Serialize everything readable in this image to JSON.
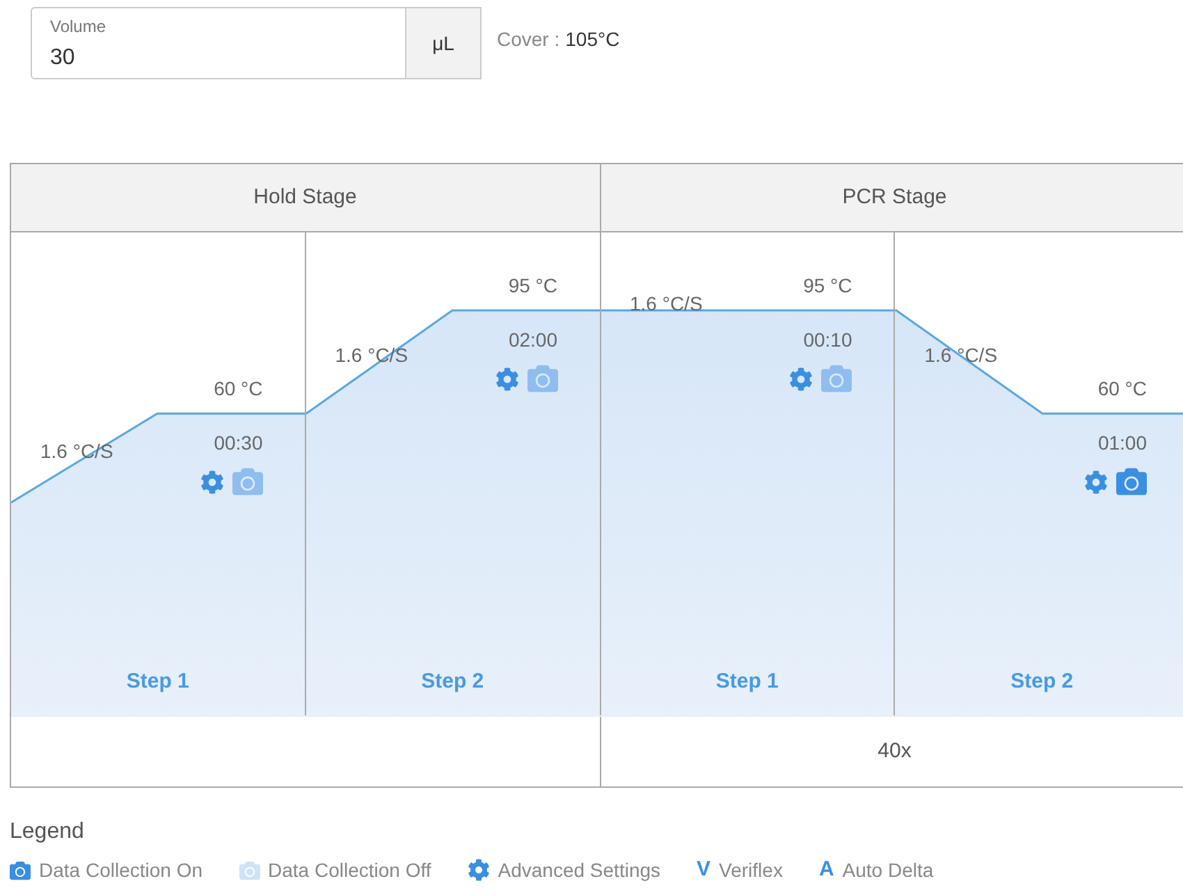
{
  "volume": {
    "label": "Volume",
    "value": "30",
    "unit": "μL"
  },
  "cover": {
    "label": "Cover :",
    "value": "105°C"
  },
  "stages": [
    {
      "title": "Hold Stage",
      "steps": [
        {
          "name": "Step 1",
          "ramp": "1.6 °C/S",
          "temp": "60 °C",
          "time": "00:30",
          "data_collection": false
        },
        {
          "name": "Step 2",
          "ramp": "1.6 °C/S",
          "temp": "95 °C",
          "time": "02:00",
          "data_collection": false
        }
      ]
    },
    {
      "title": "PCR Stage",
      "cycles": "40x",
      "steps": [
        {
          "name": "Step 1",
          "ramp": "1.6 °C/S",
          "temp": "95 °C",
          "time": "00:10",
          "data_collection": false
        },
        {
          "name": "Step 2",
          "ramp": "1.6 °C/S",
          "temp": "60 °C",
          "time": "01:00",
          "data_collection": true
        }
      ]
    }
  ],
  "legend": {
    "title": "Legend",
    "items": [
      {
        "kind": "camera_on",
        "label": "Data Collection On"
      },
      {
        "kind": "camera_off",
        "label": "Data Collection Off"
      },
      {
        "kind": "gear",
        "label": "Advanced Settings"
      },
      {
        "kind": "letter",
        "symbol": "V",
        "label": "Veriflex"
      },
      {
        "kind": "letter",
        "symbol": "A",
        "label": "Auto Delta"
      }
    ]
  }
}
